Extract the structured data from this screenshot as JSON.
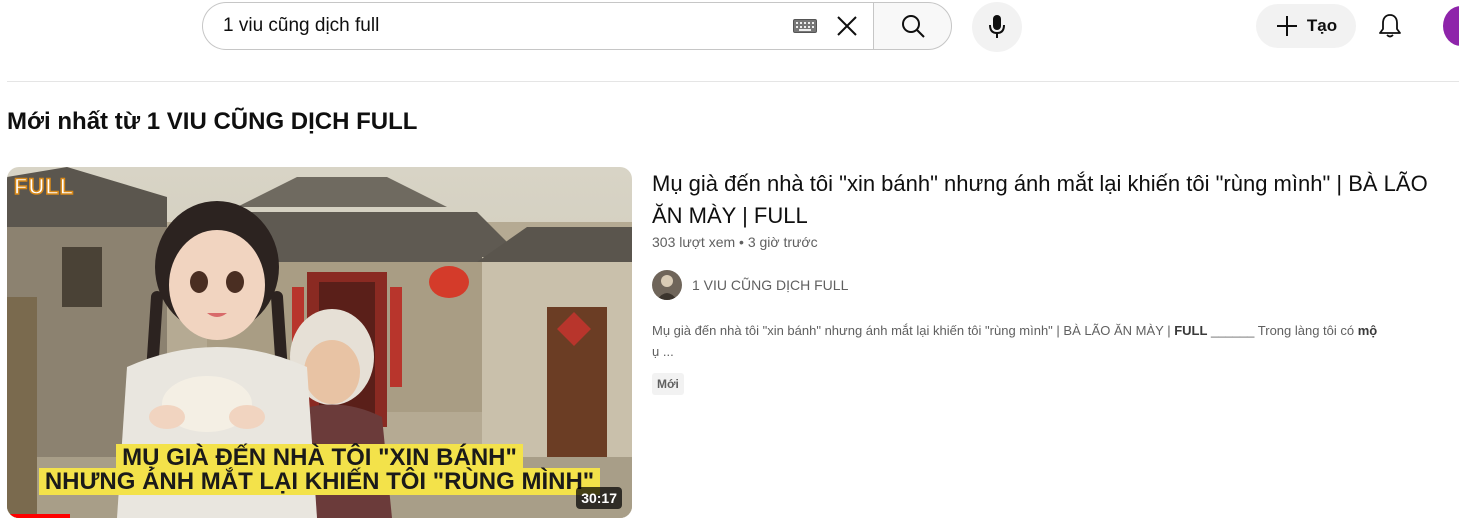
{
  "search": {
    "query": "1 viu cũng dịch full"
  },
  "header": {
    "create_label": "Tạo"
  },
  "section": {
    "title": "Mới nhất từ 1 VIU CŨNG DỊCH FULL"
  },
  "video": {
    "title": "Mụ già đến nhà tôi \"xin bánh\" nhưng ánh mắt lại khiến tôi \"rùng mình\" | BÀ LÃO ĂN MÀY | FULL",
    "views": "303 lượt xem",
    "separator": "•",
    "age": "3 giờ trước",
    "channel": "1 VIU CŨNG DỊCH FULL",
    "description_main": "Mụ già đến nhà tôi \"xin bánh\" nhưng ánh mắt lại khiến tôi \"rùng mình\" | BÀ LÃO ĂN MÀY | ",
    "description_bold": "FULL",
    "description_rest": " ______ Trong làng tôi có ",
    "description_bold2": "mộ",
    "description_line2": "ụ ...",
    "badge": "Mới",
    "duration": "30:17",
    "watch_progress": 0.1,
    "thumbnail": {
      "corner_label": "FULL",
      "caption_line1": "MỤ GIÀ ĐẾN NHÀ TÔI \"XIN BÁNH\"",
      "caption_line2": "NHƯNG ÁNH MẮT LẠI KHIẾN TÔI \"RÙNG MÌNH\""
    }
  },
  "colors": {
    "accent_red": "#ff0000",
    "avatar_purple": "#8e24aa",
    "caption_yellow": "#f3e24a",
    "secondary_text": "#606060"
  }
}
